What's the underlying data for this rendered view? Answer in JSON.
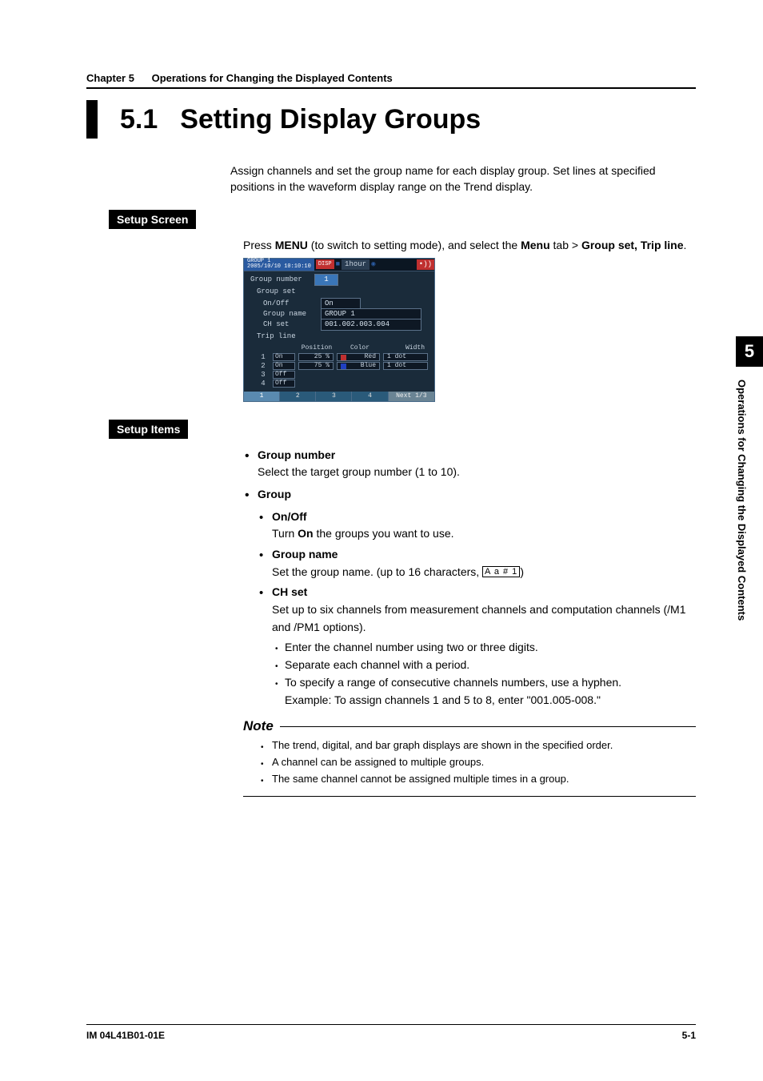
{
  "chapter": {
    "num": "Chapter 5",
    "title": "Operations for Changing the Displayed Contents"
  },
  "section": {
    "num": "5.1",
    "title": "Setting Display Groups"
  },
  "intro": "Assign channels and set the group name for each display group. Set lines at specified positions in the waveform display range on the Trend display.",
  "setupScreen": {
    "label": "Setup Screen",
    "line1_a": "Press ",
    "menu": "MENU",
    "line1_b": " (to switch to setting mode), and select the ",
    "menuTab": "Menu",
    "line1_c": " tab > ",
    "target": "Group set, Trip line",
    "period": "."
  },
  "device": {
    "top": {
      "group": "GROUP 1",
      "datetime": "2005/10/10 10:10:10",
      "disp": "DISP",
      "time": "1hour"
    },
    "groupNumber": {
      "label": "Group number",
      "value": "1"
    },
    "groupSet": "Group set",
    "onoff": {
      "label": "On/Off",
      "value": "On"
    },
    "groupName": {
      "label": "Group name",
      "value": "GROUP 1"
    },
    "chSet": {
      "label": "CH set",
      "value": "001.002.003.004"
    },
    "tripLine": "Trip line",
    "tripHead": {
      "pos": "Position",
      "color": "Color",
      "width": "Width"
    },
    "rows": [
      {
        "idx": "1",
        "onoff": "On",
        "pos": "25 %",
        "swatch": "#c03030",
        "color": "Red",
        "width": "1 dot"
      },
      {
        "idx": "2",
        "onoff": "On",
        "pos": "75 %",
        "swatch": "#2040c0",
        "color": "Blue",
        "width": "1 dot"
      },
      {
        "idx": "3",
        "onoff": "Off"
      },
      {
        "idx": "4",
        "onoff": "Off"
      }
    ],
    "footer": [
      "1",
      "2",
      "3",
      "4",
      "Next 1/3"
    ]
  },
  "setupItems": {
    "label": "Setup Items",
    "groupNumber": {
      "head": "Group number",
      "body": "Select the target group number (1 to 10)."
    },
    "group": {
      "head": "Group",
      "onoff_h": "On/Off",
      "onoff_a": "Turn ",
      "onoff_on": "On",
      "onoff_b": " the groups you want to use.",
      "gname_h": "Group name",
      "gname_a": "Set the group name. (up to 16 characters, ",
      "gname_box": "A a # 1",
      "gname_b": ")",
      "chset_h": "CH set",
      "chset_body": "Set up to six channels from measurement channels and computation channels (/M1 and /PM1 options).",
      "ch_b1": "Enter the channel number using two or three digits.",
      "ch_b2": "Separate each channel with a period.",
      "ch_b3a": "To specify a range of consecutive channels numbers, use a hyphen.",
      "ch_b3b": "Example: To assign channels 1 and 5 to 8, enter \"001.005-008.\""
    }
  },
  "note": {
    "head": "Note",
    "items": [
      "The trend, digital, and bar graph displays are shown in the specified order.",
      "A channel can be assigned to multiple groups.",
      "The same channel cannot be assigned multiple times in a group."
    ]
  },
  "sideTab": {
    "num": "5",
    "text": "Operations for Changing the Displayed Contents"
  },
  "footer": {
    "left": "IM 04L41B01-01E",
    "right": "5-1"
  }
}
